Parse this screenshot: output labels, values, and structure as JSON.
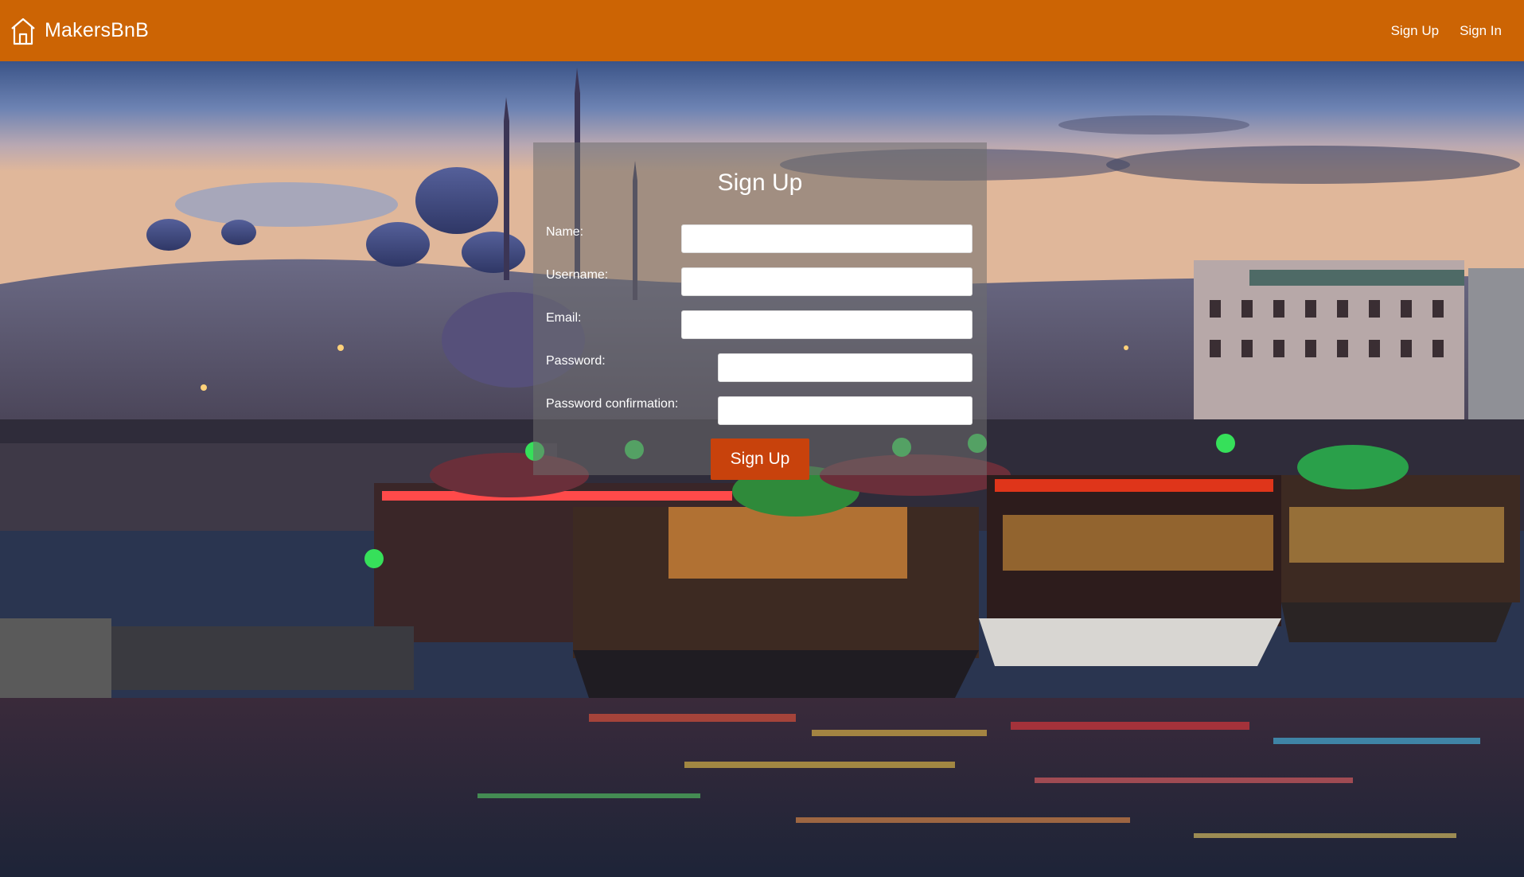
{
  "navbar": {
    "brand": "MakersBnB",
    "links": [
      "Sign Up",
      "Sign In"
    ],
    "background": "#cc6404"
  },
  "form": {
    "title": "Sign Up",
    "fields": [
      {
        "label": "Name:",
        "value": ""
      },
      {
        "label": "Username:",
        "value": ""
      },
      {
        "label": "Email:",
        "value": ""
      },
      {
        "label": "Password:",
        "value": ""
      },
      {
        "label": "Password confirmation:",
        "value": ""
      }
    ],
    "submit": "Sign Up",
    "submit_color": "#c8420c"
  },
  "icons": {
    "brand_icon": "house-icon"
  }
}
